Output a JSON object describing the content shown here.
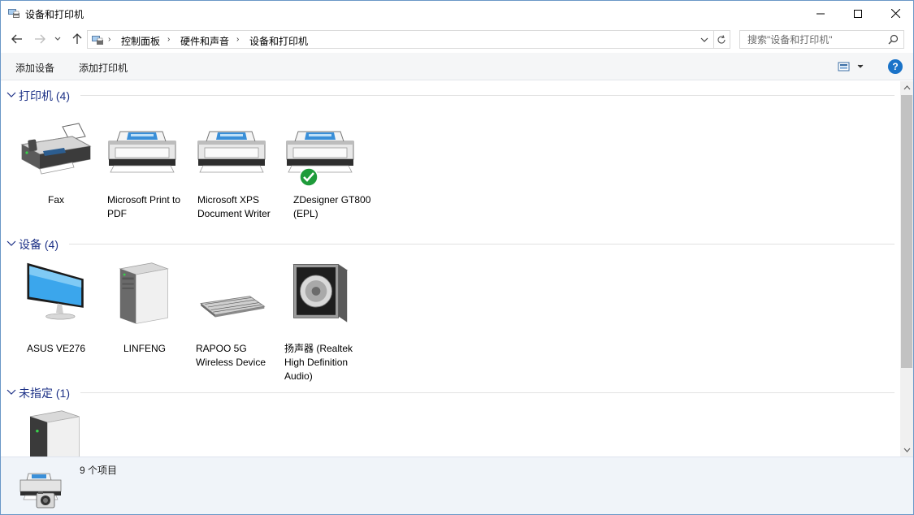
{
  "window": {
    "title": "设备和打印机"
  },
  "nav": {
    "breadcrumb": [
      "控制面板",
      "硬件和声音",
      "设备和打印机"
    ]
  },
  "search": {
    "placeholder": "搜索\"设备和打印机\""
  },
  "commands": {
    "add_device": "添加设备",
    "add_printer": "添加打印机",
    "help": "?"
  },
  "groups": [
    {
      "title": "打印机 (4)",
      "items": [
        {
          "label": "Fax",
          "icon": "fax-icon"
        },
        {
          "label": "Microsoft Print to PDF",
          "icon": "printer-icon"
        },
        {
          "label": "Microsoft XPS Document Writer",
          "icon": "printer-icon"
        },
        {
          "label": "ZDesigner GT800 (EPL)",
          "icon": "printer-icon",
          "default": true
        }
      ]
    },
    {
      "title": "设备 (4)",
      "items": [
        {
          "label": "ASUS VE276",
          "icon": "monitor-icon"
        },
        {
          "label": "LINFENG",
          "icon": "computer-tower-icon"
        },
        {
          "label": "RAPOO 5G Wireless Device",
          "icon": "keyboard-icon"
        },
        {
          "label": "扬声器 (Realtek High Definition Audio)",
          "icon": "speaker-icon"
        }
      ]
    },
    {
      "title": "未指定 (1)",
      "items": [
        {
          "label": "",
          "icon": "computer-tower-icon"
        }
      ]
    }
  ],
  "status": {
    "count": "9 个项目"
  },
  "colors": {
    "group_title": "#1e3287",
    "accent": "#1a73c8",
    "default_check": "#1e9b3a"
  }
}
